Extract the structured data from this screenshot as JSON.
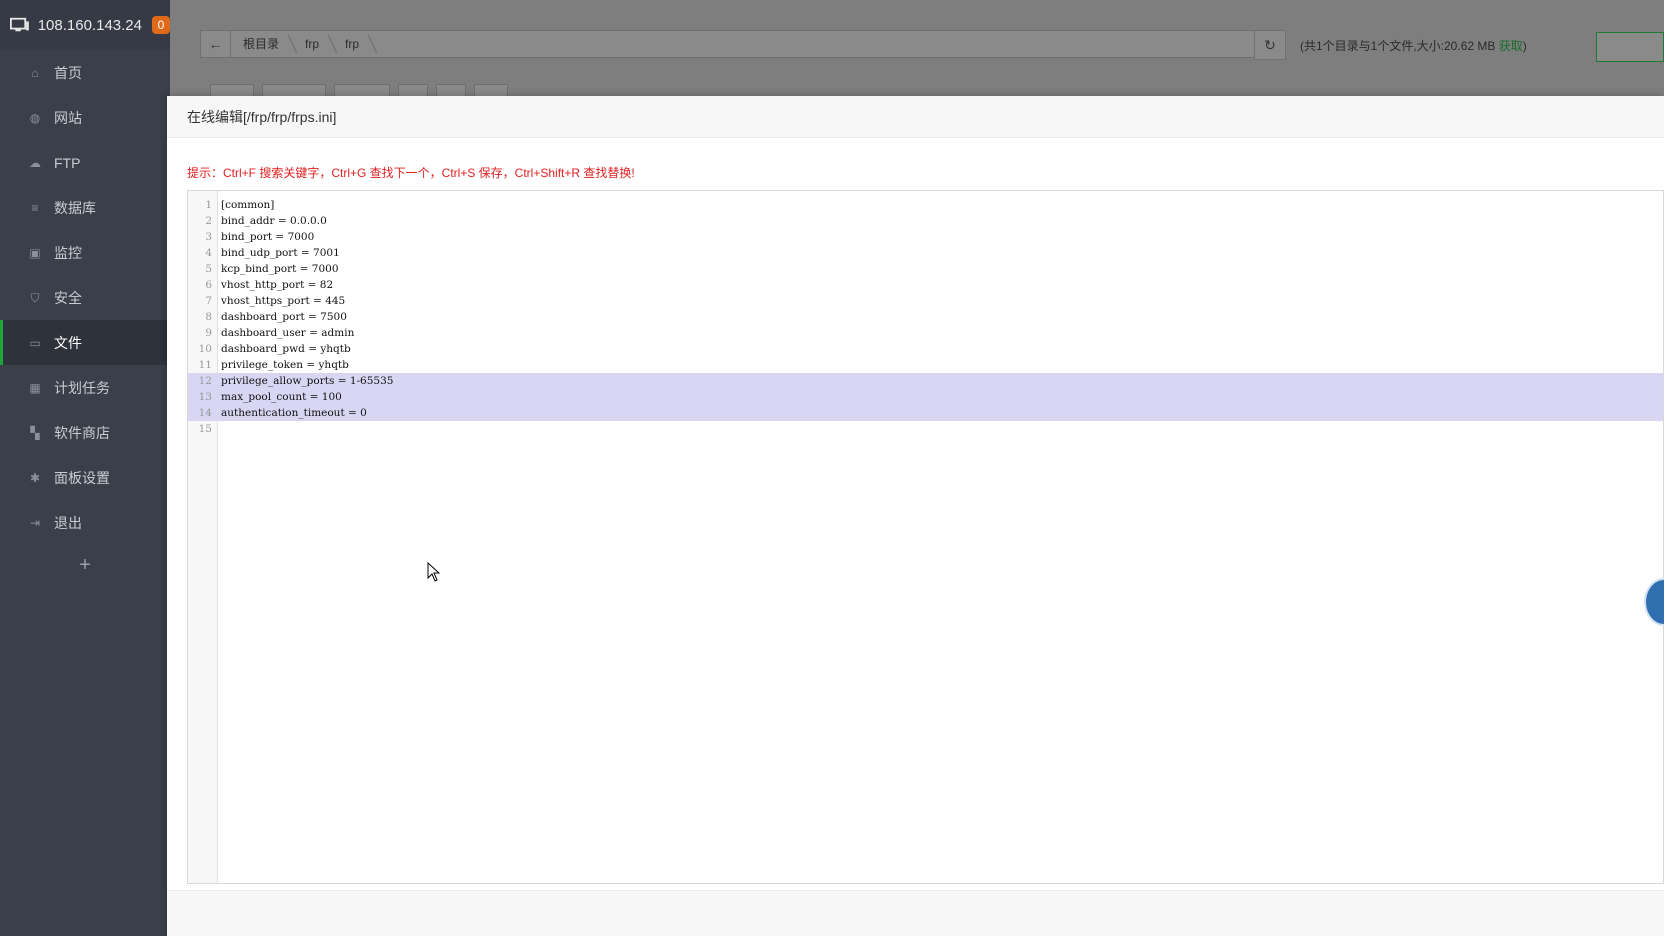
{
  "sidebar": {
    "server_ip": "108.160.143.24",
    "badge_count": "0",
    "items": [
      {
        "label": "首页",
        "icon": "home-icon"
      },
      {
        "label": "网站",
        "icon": "globe-icon"
      },
      {
        "label": "FTP",
        "icon": "ftp-icon"
      },
      {
        "label": "数据库",
        "icon": "database-icon"
      },
      {
        "label": "监控",
        "icon": "monitor-icon"
      },
      {
        "label": "安全",
        "icon": "shield-icon"
      },
      {
        "label": "文件",
        "icon": "folder-icon",
        "active": true
      },
      {
        "label": "计划任务",
        "icon": "calendar-icon"
      },
      {
        "label": "软件商店",
        "icon": "grid-icon"
      },
      {
        "label": "面板设置",
        "icon": "gear-icon"
      },
      {
        "label": "退出",
        "icon": "logout-icon"
      }
    ],
    "add_label": "+"
  },
  "file_manager": {
    "breadcrumbs": [
      "根目录",
      "frp",
      "frp"
    ],
    "summary": "(共1个目录与1个文件,大小:20.62 MB ",
    "summary_link": "获取",
    "summary_end": ")"
  },
  "editor_modal": {
    "title": "在线编辑[/frp/frp/frps.ini]",
    "hint": "提示：Ctrl+F 搜索关键字，Ctrl+G 查找下一个，Ctrl+S 保存，Ctrl+Shift+R 查找替换!",
    "lines": [
      "[common]",
      "bind_addr = 0.0.0.0",
      "bind_port = 7000",
      "bind_udp_port = 7001",
      "kcp_bind_port = 7000",
      "vhost_http_port = 82",
      "vhost_https_port = 445",
      "dashboard_port = 7500",
      "dashboard_user = admin",
      "dashboard_pwd = yhqtb",
      "privilege_token = yhqtb",
      "privilege_allow_ports = 1-65535",
      "max_pool_count = 100",
      "authentication_timeout = 0",
      ""
    ],
    "selected_lines": [
      12,
      13,
      14
    ]
  },
  "colors": {
    "sidebar_bg": "#3a3f4a",
    "active_accent": "#20a53a",
    "badge": "#e0691a",
    "hint": "#e02020",
    "selection": "#d8d6f2"
  }
}
